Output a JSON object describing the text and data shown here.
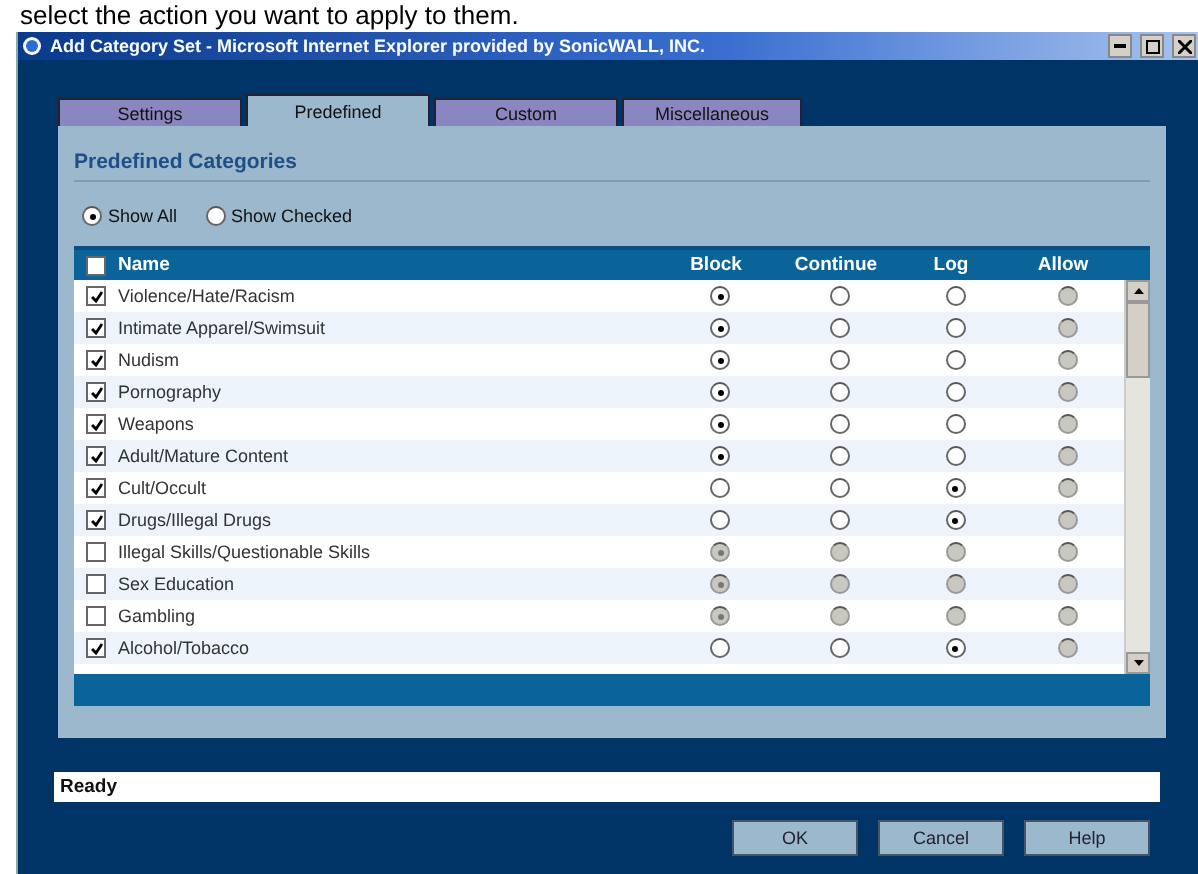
{
  "caption": "select the action you want to apply to them.",
  "window": {
    "title": "Add Category Set - Microsoft Internet Explorer provided by SonicWALL, INC."
  },
  "tabs": [
    {
      "label": "Settings",
      "selected": false
    },
    {
      "label": "Predefined",
      "selected": true
    },
    {
      "label": "Custom",
      "selected": false
    },
    {
      "label": "Miscellaneous",
      "selected": false
    }
  ],
  "section_title": "Predefined Categories",
  "filters": [
    {
      "label": "Show All",
      "selected": true
    },
    {
      "label": "Show Checked",
      "selected": false
    }
  ],
  "table": {
    "select_all_checked": false,
    "name_column": "Name",
    "actions": [
      {
        "label": "Block",
        "disabled": false
      },
      {
        "label": "Continue",
        "disabled": false
      },
      {
        "label": "Log",
        "disabled": false
      },
      {
        "label": "Allow",
        "disabled": true
      }
    ],
    "rows": [
      {
        "name": "Violence/Hate/Racism",
        "checked": true,
        "choices": [
          {
            "selected": true
          },
          {
            "selected": false
          },
          {
            "selected": false
          },
          {
            "selected": false
          }
        ]
      },
      {
        "name": "Intimate Apparel/Swimsuit",
        "checked": true,
        "choices": [
          {
            "selected": true
          },
          {
            "selected": false
          },
          {
            "selected": false
          },
          {
            "selected": false
          }
        ]
      },
      {
        "name": "Nudism",
        "checked": true,
        "choices": [
          {
            "selected": true
          },
          {
            "selected": false
          },
          {
            "selected": false
          },
          {
            "selected": false
          }
        ]
      },
      {
        "name": "Pornography",
        "checked": true,
        "choices": [
          {
            "selected": true
          },
          {
            "selected": false
          },
          {
            "selected": false
          },
          {
            "selected": false
          }
        ]
      },
      {
        "name": "Weapons",
        "checked": true,
        "choices": [
          {
            "selected": true
          },
          {
            "selected": false
          },
          {
            "selected": false
          },
          {
            "selected": false
          }
        ]
      },
      {
        "name": "Adult/Mature Content",
        "checked": true,
        "choices": [
          {
            "selected": true
          },
          {
            "selected": false
          },
          {
            "selected": false
          },
          {
            "selected": false
          }
        ]
      },
      {
        "name": "Cult/Occult",
        "checked": true,
        "choices": [
          {
            "selected": false
          },
          {
            "selected": false
          },
          {
            "selected": true
          },
          {
            "selected": false
          }
        ]
      },
      {
        "name": "Drugs/Illegal Drugs",
        "checked": true,
        "choices": [
          {
            "selected": false
          },
          {
            "selected": false
          },
          {
            "selected": true
          },
          {
            "selected": false
          }
        ]
      },
      {
        "name": "Illegal Skills/Questionable Skills",
        "checked": false,
        "choices": [
          {
            "selected": true
          },
          {
            "selected": false
          },
          {
            "selected": false
          },
          {
            "selected": false
          }
        ]
      },
      {
        "name": "Sex Education",
        "checked": false,
        "choices": [
          {
            "selected": true
          },
          {
            "selected": false
          },
          {
            "selected": false
          },
          {
            "selected": false
          }
        ]
      },
      {
        "name": "Gambling",
        "checked": false,
        "choices": [
          {
            "selected": true
          },
          {
            "selected": false
          },
          {
            "selected": false
          },
          {
            "selected": false
          }
        ]
      },
      {
        "name": "Alcohol/Tobacco",
        "checked": true,
        "choices": [
          {
            "selected": false
          },
          {
            "selected": false
          },
          {
            "selected": true
          },
          {
            "selected": false
          }
        ]
      }
    ]
  },
  "status_bar": "Ready",
  "buttons": [
    "OK",
    "Cancel",
    "Help"
  ]
}
